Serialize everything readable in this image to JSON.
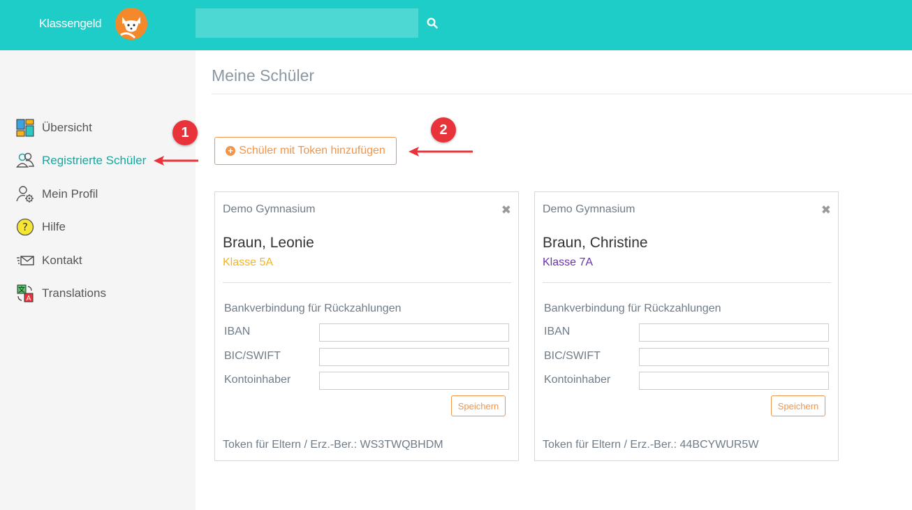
{
  "header": {
    "logo_text": "Klassengeld",
    "search_placeholder": "",
    "colors": {
      "bar": "#1fcdc8",
      "search": "#4dd8d4"
    }
  },
  "sidebar": {
    "items": [
      {
        "label": "Übersicht",
        "icon": "dashboard-icon",
        "active": false
      },
      {
        "label": "Registrierte Schüler",
        "icon": "users-icon",
        "active": true
      },
      {
        "label": "Mein Profil",
        "icon": "user-gear-icon",
        "active": false
      },
      {
        "label": "Hilfe",
        "icon": "help-icon",
        "active": false
      },
      {
        "label": "Kontakt",
        "icon": "envelope-icon",
        "active": false
      },
      {
        "label": "Translations",
        "icon": "translate-icon",
        "active": false
      }
    ],
    "active_color": "#19a69f"
  },
  "annotations": {
    "badge1": "1",
    "badge2": "2",
    "color": "#e8333a"
  },
  "main": {
    "title": "Meine Schüler",
    "add_button_label": "Schüler mit Token hinzufügen",
    "cards": [
      {
        "school": "Demo Gymnasium",
        "name": "Braun, Leonie",
        "klasse": "Klasse 5A",
        "klasse_color": "#f5b41c",
        "bank_heading": "Bankverbindung für Rückzahlungen",
        "iban_label": "IBAN",
        "bic_label": "BIC/SWIFT",
        "owner_label": "Kontoinhaber",
        "iban_value": "",
        "bic_value": "",
        "owner_value": "",
        "save_label": "Speichern",
        "token": "Token für Eltern / Erz.-Ber.: WS3TWQBHDM"
      },
      {
        "school": "Demo Gymnasium",
        "name": "Braun, Christine",
        "klasse": "Klasse 7A",
        "klasse_color": "#6a2fb0",
        "bank_heading": "Bankverbindung für Rückzahlungen",
        "iban_label": "IBAN",
        "bic_label": "BIC/SWIFT",
        "owner_label": "Kontoinhaber",
        "iban_value": "",
        "bic_value": "",
        "owner_value": "",
        "save_label": "Speichern",
        "token": "Token für Eltern / Erz.-Ber.: 44BCYWUR5W"
      }
    ],
    "accent_color": "#f0954b"
  }
}
